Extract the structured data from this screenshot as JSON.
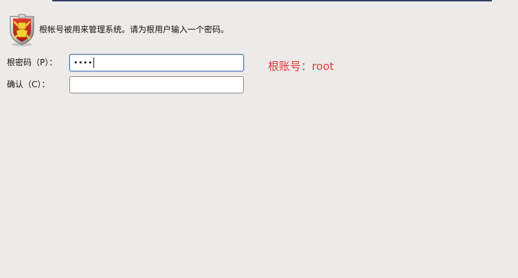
{
  "header": {
    "icon": "shield-crown-icon",
    "text": "根帐号被用来管理系统。请为根用户输入一个密码。"
  },
  "form": {
    "password": {
      "label": "根密码（P）：",
      "value_masked": "••••"
    },
    "confirm": {
      "label": "确认（C）：",
      "value_masked": ""
    }
  },
  "annotation": {
    "text": "根账号：root",
    "color": "#e8373b"
  },
  "colors": {
    "background": "#edebe9",
    "focus_border": "#4a79b0",
    "top_rule": "#2c3b63"
  }
}
